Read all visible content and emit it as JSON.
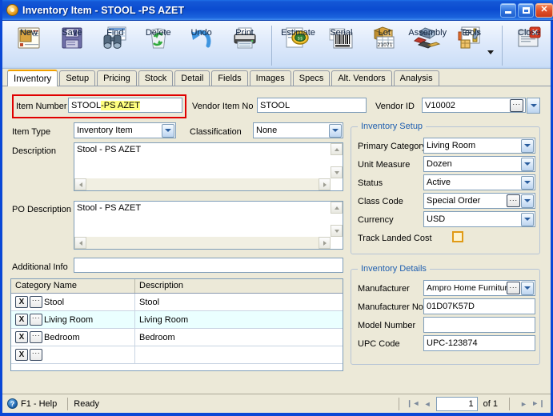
{
  "window": {
    "title": "Inventory Item  -  STOOL  -PS AZET",
    "icon": "inventory-item-icon",
    "minimize_label": "Minimize",
    "maximize_label": "Maximize",
    "close_label": "Close"
  },
  "toolbar": {
    "buttons": [
      {
        "label": "New",
        "icon": "new-document-icon"
      },
      {
        "label": "Save",
        "icon": "floppy-disk-icon"
      },
      {
        "label": "Find",
        "icon": "binoculars-icon"
      },
      {
        "label": "Delete",
        "icon": "recycle-bin-icon"
      },
      {
        "label": "Undo",
        "icon": "undo-arrow-icon"
      },
      {
        "label": "Print",
        "icon": "printer-icon"
      },
      {
        "label": "Estimate",
        "icon": "estimate-tag-icon"
      },
      {
        "label": "Serial",
        "icon": "barcode-icon"
      },
      {
        "label": "Lot",
        "icon": "lot-box-icon"
      },
      {
        "label": "Assembly",
        "icon": "assembly-blocks-icon"
      },
      {
        "label": "Tools",
        "icon": "tools-wrench-icon"
      },
      {
        "label": "Close",
        "icon": "close-window-icon"
      }
    ]
  },
  "tabs": [
    {
      "label": "Inventory",
      "active": true
    },
    {
      "label": "Setup",
      "active": false
    },
    {
      "label": "Pricing",
      "active": false
    },
    {
      "label": "Stock",
      "active": false
    },
    {
      "label": "Detail",
      "active": false
    },
    {
      "label": "Fields",
      "active": false
    },
    {
      "label": "Images",
      "active": false
    },
    {
      "label": "Specs",
      "active": false
    },
    {
      "label": "Alt. Vendors",
      "active": false
    },
    {
      "label": "Analysis",
      "active": false
    }
  ],
  "form": {
    "item_number_label": "Item Number",
    "item_number_value_plain": "STOOL ",
    "item_number_value_selected": "-PS AZET",
    "vendor_item_no_label": "Vendor Item No",
    "vendor_item_no_value": "STOOL",
    "vendor_id_label": "Vendor ID",
    "vendor_id_value": "V10002",
    "item_type_label": "Item Type",
    "item_type_value": "Inventory Item",
    "classification_label": "Classification",
    "classification_value": "None",
    "description_label": "Description",
    "description_value": "Stool - PS AZET",
    "po_description_label": "PO Description",
    "po_description_value": "Stool - PS AZET",
    "additional_info_label": "Additional Info",
    "additional_info_value": ""
  },
  "inventory_setup": {
    "title": "Inventory Setup",
    "rows": [
      {
        "label": "Primary Category",
        "value": "Living Room",
        "type": "combo"
      },
      {
        "label": "Unit Measure",
        "value": "Dozen",
        "type": "combo"
      },
      {
        "label": "Status",
        "value": "Active",
        "type": "combo"
      },
      {
        "label": "Class Code",
        "value": "Special Order",
        "type": "combo-lookup"
      },
      {
        "label": "Currency",
        "value": "USD",
        "type": "combo"
      }
    ],
    "track_landed_cost_label": "Track Landed Cost",
    "track_landed_cost_checked": false
  },
  "inventory_details": {
    "title": "Inventory Details",
    "rows": [
      {
        "label": "Manufacturer",
        "value": "Ampro Home Furniture",
        "type": "combo-lookup"
      },
      {
        "label": "Manufacturer No",
        "value": "01D07K57D",
        "type": "text"
      },
      {
        "label": "Model Number",
        "value": "",
        "type": "text"
      },
      {
        "label": "UPC Code",
        "value": "UPC-123874",
        "type": "text"
      }
    ]
  },
  "category_grid": {
    "columns": [
      "Category Name",
      "Description"
    ],
    "rows": [
      {
        "name": "Stool",
        "description": "Stool",
        "selected": false
      },
      {
        "name": "Living Room",
        "description": "Living Room",
        "selected": true
      },
      {
        "name": "Bedroom",
        "description": "Bedroom",
        "selected": false
      },
      {
        "name": "",
        "description": "",
        "selected": false
      }
    ],
    "delete_glyph": "X",
    "lookup_glyph": "···"
  },
  "statusbar": {
    "help_text": "F1 - Help",
    "status_text": "Ready",
    "page_value": "1",
    "of_text": "of  1",
    "first_glyph": "❙◄",
    "prev_glyph": "◄",
    "next_glyph": "►",
    "last_glyph": "►❙"
  },
  "colors": {
    "titlebar_blue": "#0b4bd0",
    "window_border": "#0a48d6",
    "face": "#ece9d8",
    "accent_orange": "#f0a000",
    "group_title": "#1f5fb0",
    "highlight_yellow": "#ffff80",
    "selection_red": "#e00000",
    "row_selected": "#eaffff"
  }
}
